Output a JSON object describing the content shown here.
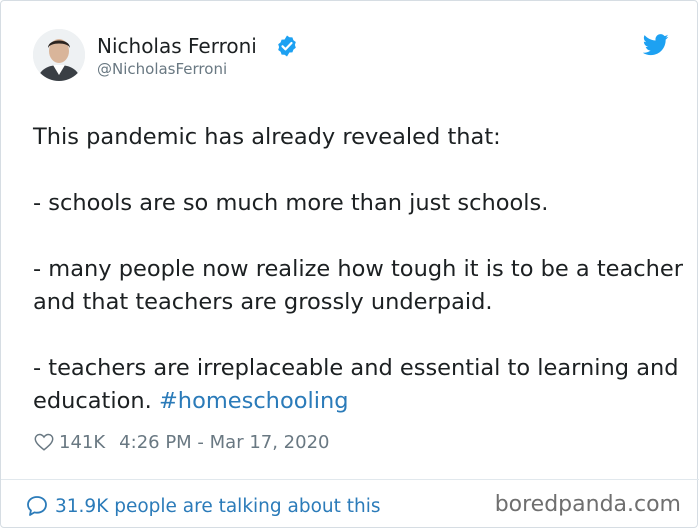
{
  "author": {
    "name": "Nicholas Ferroni",
    "handle": "@NicholasFerroni",
    "verified": true
  },
  "tweet": {
    "line1": "This pandemic has already revealed that:",
    "bullet1": "- schools are so much more than just schools.",
    "bullet2": "- many people now realize how tough it is to be a teacher and that teachers are grossly underpaid.",
    "bullet3_text": "- teachers are irreplaceable and essential to learning and education. ",
    "hashtag": "#homeschooling"
  },
  "meta": {
    "likes": "141K",
    "timestamp": "4:26 PM - Mar 17, 2020"
  },
  "footer": {
    "talking": "31.9K people are talking about this",
    "watermark": "boredpanda.com"
  },
  "colors": {
    "text": "#1c2022",
    "secondary": "#697882",
    "link": "#2b7bb9",
    "verified": "#1da1f2",
    "twitter_bird": "#1da1f2"
  },
  "icons": {
    "verified": "verified-badge-icon",
    "bird": "twitter-bird-icon",
    "heart": "heart-icon",
    "bubble": "speech-bubble-icon"
  }
}
